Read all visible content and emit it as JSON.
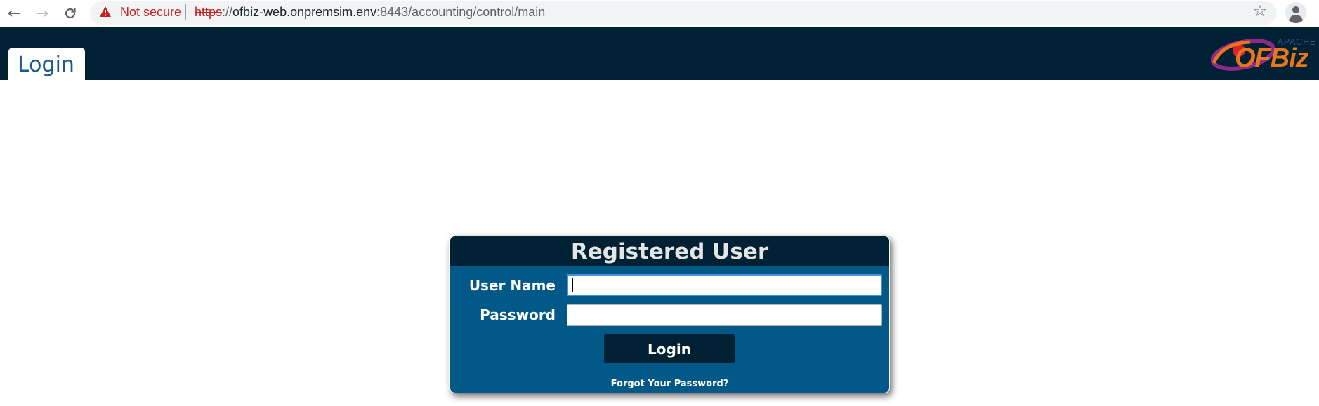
{
  "browser": {
    "back_icon": "arrow-left-icon",
    "forward_icon": "arrow-right-icon",
    "reload_icon": "reload-icon",
    "security_warning": "Not secure",
    "url_scheme": "https",
    "url_rest": "://",
    "url_host": "ofbiz-web.onpremsim.env",
    "url_path": ":8443/accounting/control/main",
    "bookmark_icon": "star-icon",
    "profile_icon": "profile-icon"
  },
  "header": {
    "tab_label": "Login",
    "logo_apache": "APACHE",
    "logo_text": "OFBiz",
    "background_color": "#002133"
  },
  "login_form": {
    "title": "Registered User",
    "username_label": "User Name",
    "username_value": "",
    "password_label": "Password",
    "password_value": "",
    "submit_label": "Login",
    "forgot_password_label": "Forgot Your Password?",
    "panel_color": "#025886"
  }
}
